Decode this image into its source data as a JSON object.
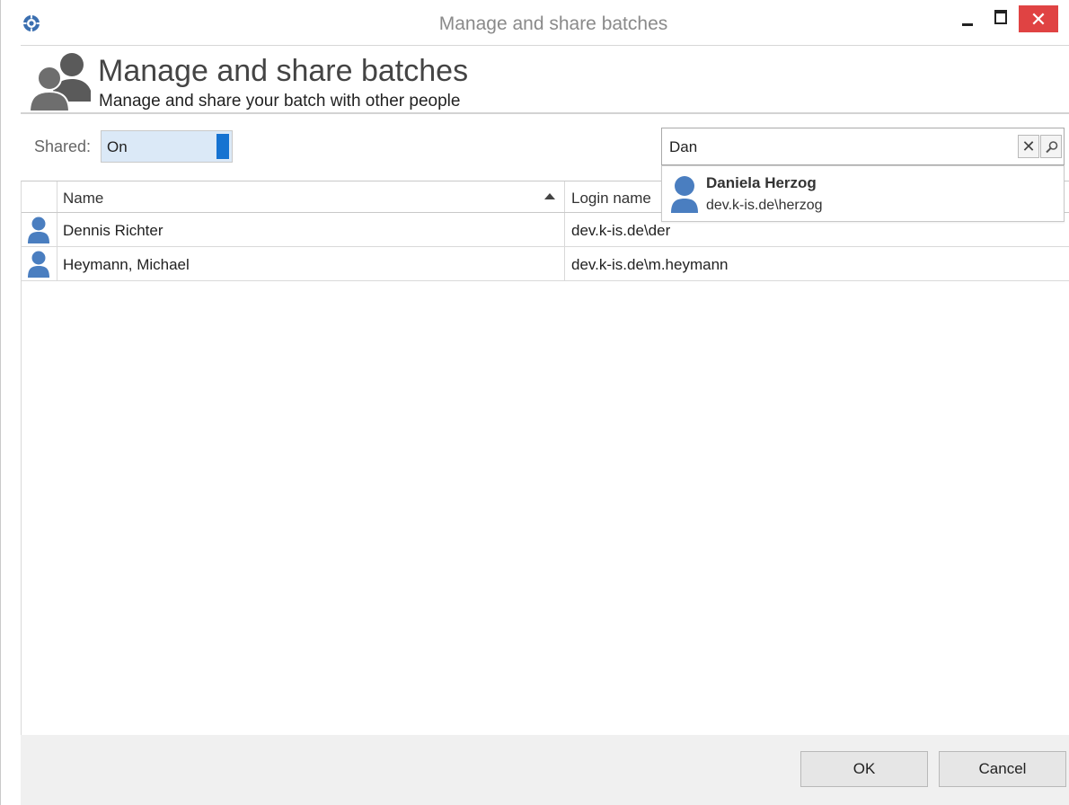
{
  "window": {
    "title": "Manage and share batches",
    "icon": "app-logo-icon",
    "controls": {
      "minimize": "minimize-icon",
      "maximize": "maximize-icon",
      "close": "✕"
    }
  },
  "header": {
    "title": "Manage and share batches",
    "subtitle": "Manage and share your batch with other people",
    "icon": "users-icon"
  },
  "shared": {
    "label": "Shared:",
    "value": "On",
    "accent": "#1673d1"
  },
  "search": {
    "value": "Dan",
    "clear_label": "✕",
    "search_icon": "search-icon"
  },
  "suggestion": {
    "name": "Daniela Herzog",
    "login": "dev.k-is.de\\herzog",
    "icon": "user-icon"
  },
  "grid": {
    "columns": {
      "name": "Name",
      "login": "Login name"
    },
    "sort": "Name ascending",
    "rows": [
      {
        "name": "Dennis Richter",
        "login": "dev.k-is.de\\der"
      },
      {
        "name": "Heymann, Michael",
        "login": "dev.k-is.de\\m.heymann"
      }
    ]
  },
  "footer": {
    "ok_label": "OK",
    "cancel_label": "Cancel"
  },
  "colors": {
    "avatar": "#4a7ec0",
    "close_button": "#e04343",
    "toggle_background": "#dbe9f7"
  }
}
